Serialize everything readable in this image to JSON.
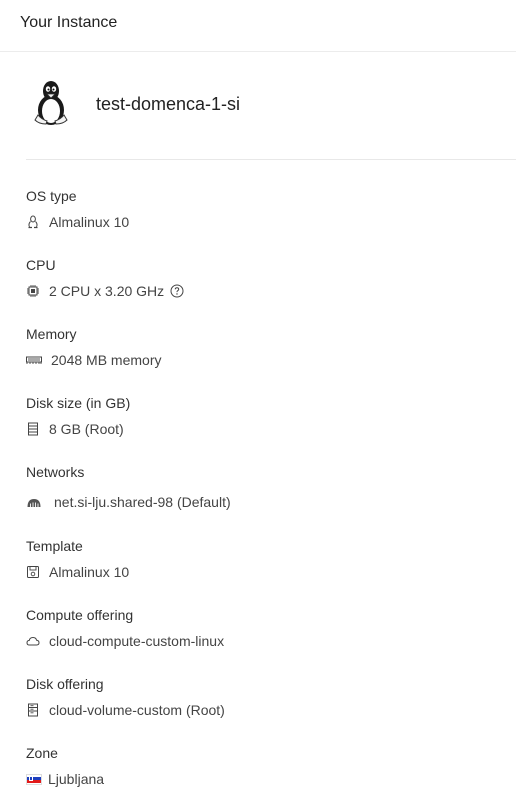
{
  "header": {
    "title": "Your Instance"
  },
  "instance": {
    "name": "test-domenca-1-si",
    "icon": "linux-penguin-icon"
  },
  "details": {
    "os_type": {
      "label": "OS type",
      "value": "Almalinux 10",
      "icon": "linux-icon"
    },
    "cpu": {
      "label": "CPU",
      "value": "2 CPU x 3.20 GHz",
      "icon": "cpu-chip-icon",
      "help_icon": "question-circle-icon"
    },
    "memory": {
      "label": "Memory",
      "value": "2048 MB memory",
      "icon": "memory-icon"
    },
    "disk_size": {
      "label": "Disk size (in GB)",
      "value": "8 GB (Root)",
      "icon": "disk-icon"
    },
    "networks": {
      "label": "Networks",
      "value": "net.si-lju.shared-98 (Default)",
      "icon": "network-api-icon"
    },
    "template": {
      "label": "Template",
      "value": "Almalinux 10",
      "icon": "save-template-icon"
    },
    "compute_offering": {
      "label": "Compute offering",
      "value": "cloud-compute-custom-linux",
      "icon": "cloud-icon"
    },
    "disk_offering": {
      "label": "Disk offering",
      "value": "cloud-volume-custom (Root)",
      "icon": "hdd-icon"
    },
    "zone": {
      "label": "Zone",
      "value": "Ljubljana",
      "icon": "slovenia-flag-icon"
    }
  },
  "colors": {
    "text": "#262626",
    "muted": "#444444",
    "divider": "#e8e8e8"
  }
}
